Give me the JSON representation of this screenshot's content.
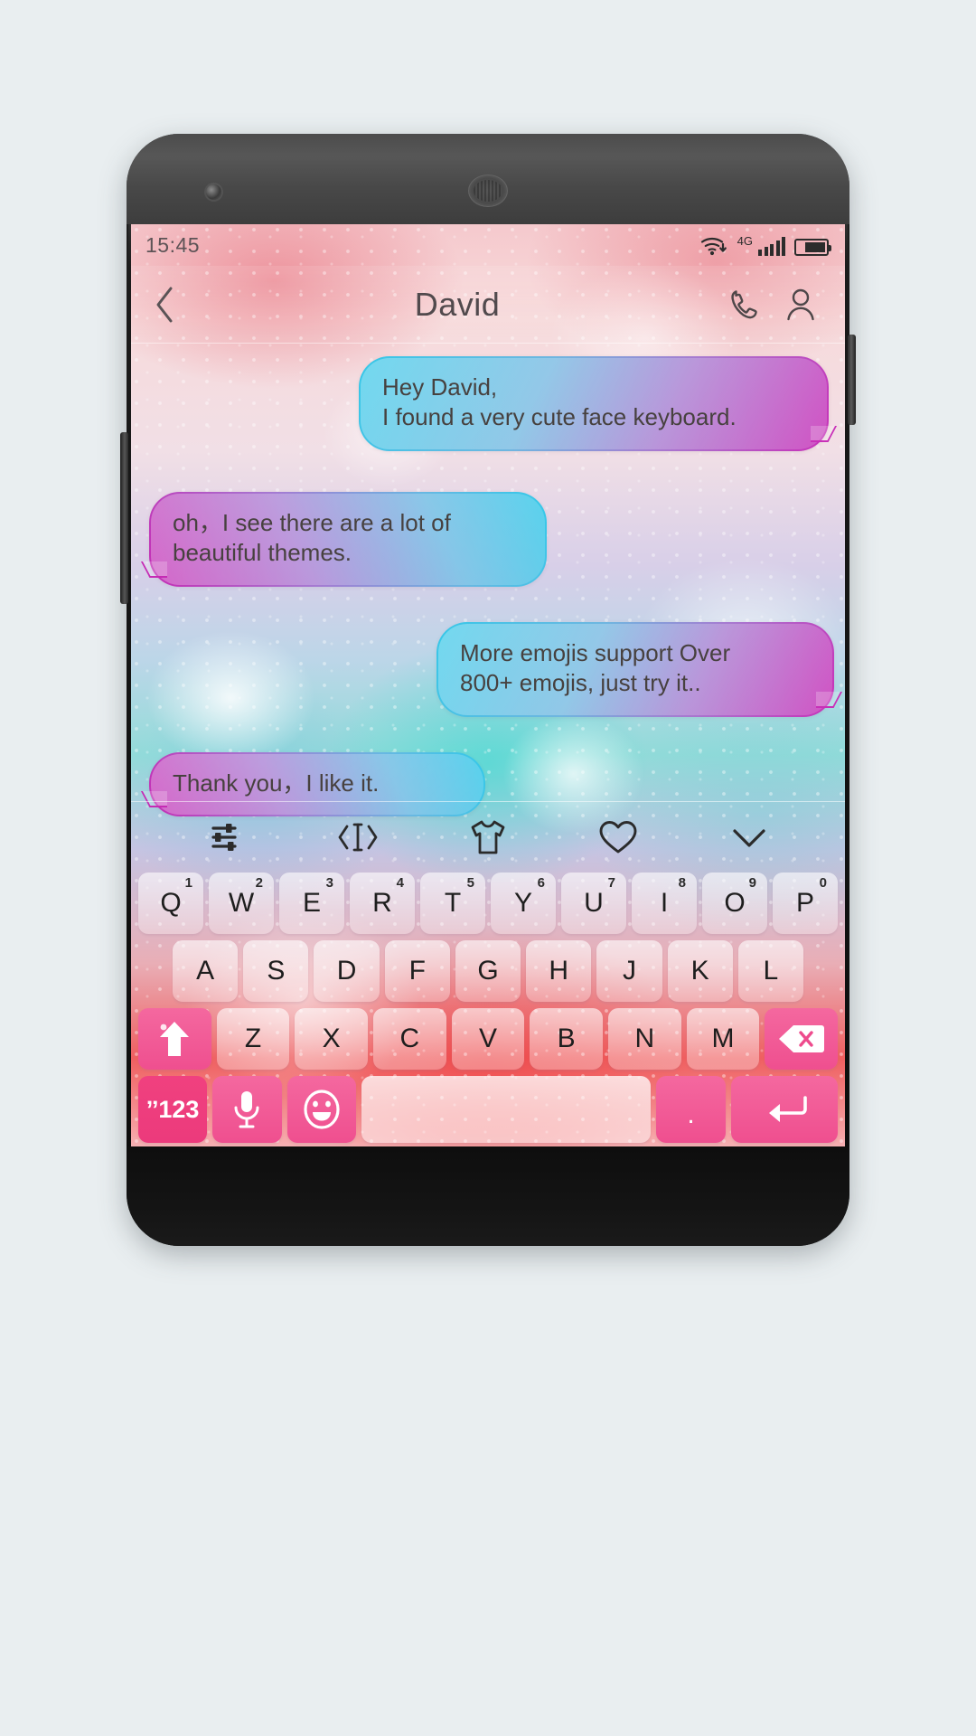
{
  "device": {
    "name": "android-phone-mockup",
    "hardware": [
      "front-camera",
      "earpiece-speaker",
      "power-button",
      "volume-button"
    ]
  },
  "status_bar": {
    "time": "15:45",
    "network_label": "4G",
    "icons": [
      "wifi-download-icon",
      "signal-bars-icon",
      "battery-icon"
    ],
    "battery_level": "74%"
  },
  "chat_header": {
    "back_icon": "chevron-left-icon",
    "title": "David",
    "actions": [
      "phone-call-icon",
      "contact-profile-icon"
    ]
  },
  "messages": [
    {
      "id": "b0",
      "side": "out",
      "text": "Hey David,\nI found a very cute face keyboard."
    },
    {
      "id": "b1",
      "side": "in",
      "text": "oh，I see there are a lot of\nbeautiful themes."
    },
    {
      "id": "b2",
      "side": "out",
      "text": "More emojis support Over\n800+ emojis, just try it.."
    },
    {
      "id": "b3",
      "side": "in",
      "text": "Thank you，I like it."
    }
  ],
  "keyboard": {
    "toolbar": [
      {
        "name": "settings-sliders-icon",
        "label": "Settings"
      },
      {
        "name": "text-cursor-icon",
        "label": "Cursor"
      },
      {
        "name": "tshirt-theme-icon",
        "label": "Themes"
      },
      {
        "name": "heart-icon",
        "label": "Favorites"
      },
      {
        "name": "chevron-down-icon",
        "label": "Hide keyboard"
      }
    ],
    "row1": [
      {
        "key": "Q",
        "num": "1"
      },
      {
        "key": "W",
        "num": "2"
      },
      {
        "key": "E",
        "num": "3"
      },
      {
        "key": "R",
        "num": "4"
      },
      {
        "key": "T",
        "num": "5"
      },
      {
        "key": "Y",
        "num": "6"
      },
      {
        "key": "U",
        "num": "7"
      },
      {
        "key": "I",
        "num": "8"
      },
      {
        "key": "O",
        "num": "9"
      },
      {
        "key": "P",
        "num": "0"
      }
    ],
    "row2": [
      "A",
      "S",
      "D",
      "F",
      "G",
      "H",
      "J",
      "K",
      "L"
    ],
    "row3": {
      "shift_icon": "shift-arrow-icon",
      "letters": [
        "Z",
        "X",
        "C",
        "V",
        "B",
        "N",
        "M"
      ],
      "backspace_icon": "backspace-delete-icon"
    },
    "row4": {
      "numeric_label": "ˮ123",
      "mic_icon": "microphone-icon",
      "emoji_icon": "emoji-smiley-icon",
      "space_label": "",
      "period_label": ".",
      "enter_icon": "enter-return-icon"
    },
    "colors": {
      "accent_pink": "#ec3a7c",
      "accent_pink_light": "#f4689f",
      "key_text": "#1e1e1e"
    }
  },
  "theme": {
    "name": "water-droplet-gradient-wallpaper",
    "bubble_gradient_start": "#33c9e9",
    "bubble_gradient_end": "#c830b8"
  }
}
